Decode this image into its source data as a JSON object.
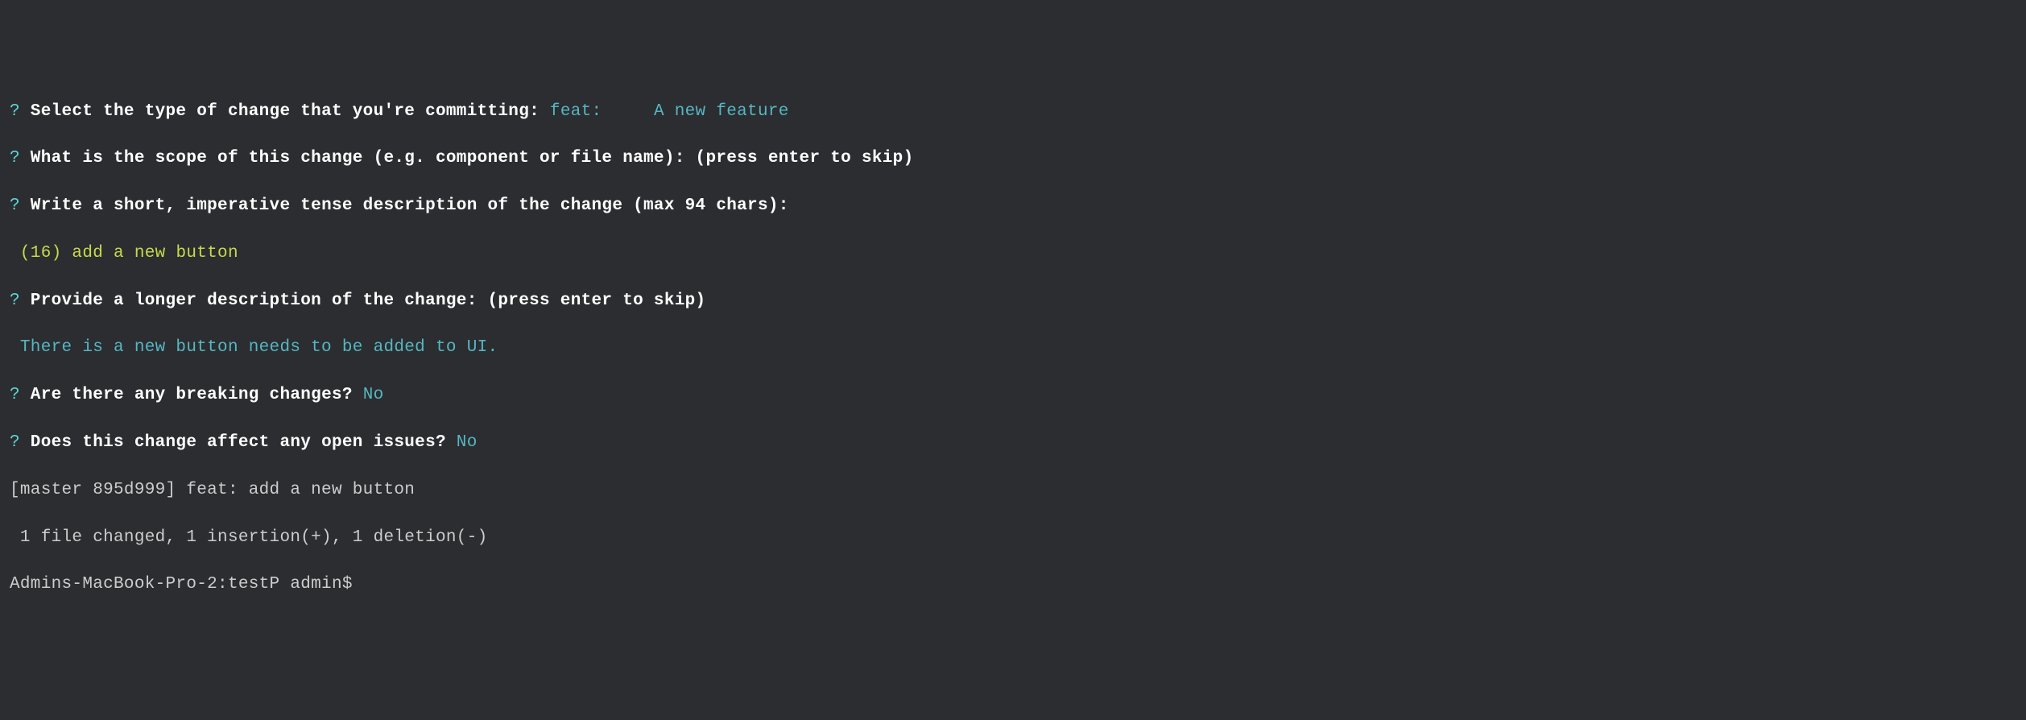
{
  "lines": {
    "l1": {
      "q": "?",
      "prompt": " Select the type of change that you're committing: ",
      "answer": "feat:     A new feature"
    },
    "l2": {
      "q": "?",
      "prompt": " What is the scope of this change (e.g. component or file name): (press enter to skip)"
    },
    "l3": {
      "q": "?",
      "prompt": " Write a short, imperative tense description of the change (max 94 chars):"
    },
    "l4": {
      "count": " (16)",
      "text": " add a new button"
    },
    "l5": {
      "q": "?",
      "prompt": " Provide a longer description of the change: (press enter to skip)"
    },
    "l6": {
      "text": " There is a new button needs to be added to UI."
    },
    "l7": {
      "q": "?",
      "prompt": " Are there any breaking changes? ",
      "answer": "No"
    },
    "l8": {
      "q": "?",
      "prompt": " Does this change affect any open issues? ",
      "answer": "No"
    },
    "l9": {
      "text": "[master 895d999] feat: add a new button"
    },
    "l10": {
      "text": " 1 file changed, 1 insertion(+), 1 deletion(-)"
    },
    "l11": {
      "text": "Admins-MacBook-Pro-2:testP admin$ "
    }
  }
}
